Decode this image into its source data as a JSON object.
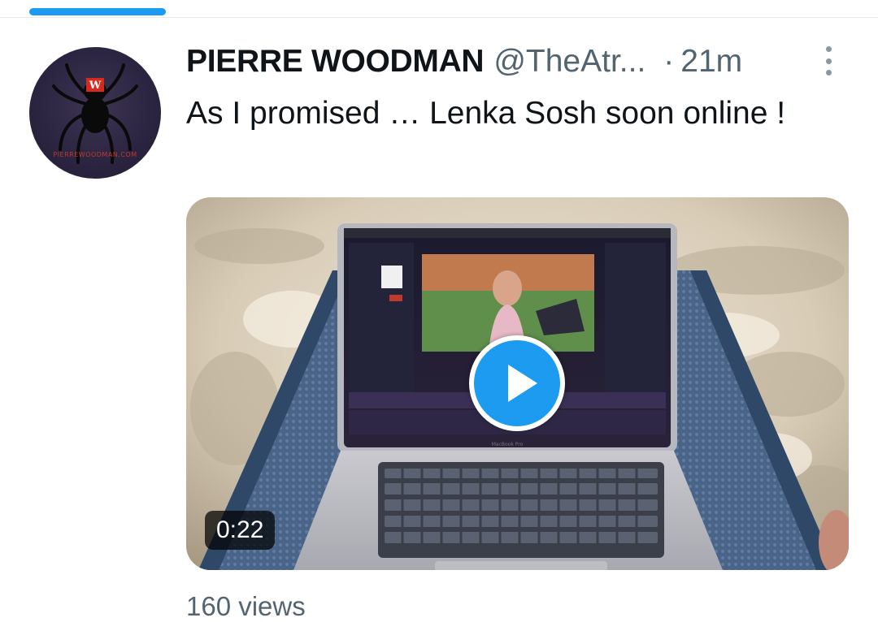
{
  "tweet": {
    "author_name": "PIERRE WOODMAN",
    "author_handle": "@TheAtr...",
    "separator": "·",
    "timestamp": "21m",
    "text": "As I promised … Lenka Sosh soon online !",
    "more_icon": "more-vertical-icon"
  },
  "avatar": {
    "logo_letter": "W",
    "caption": "PIERREWOODMAN.COM",
    "icon": "spider-logo"
  },
  "media": {
    "type": "video",
    "duration": "0:22",
    "play_icon": "play-icon",
    "laptop_label": "MacBook Pro"
  },
  "stats": {
    "views": "160 views"
  },
  "colors": {
    "accent": "#1d9bf0",
    "secondary_text": "#536471",
    "primary_text": "#0f1419"
  }
}
